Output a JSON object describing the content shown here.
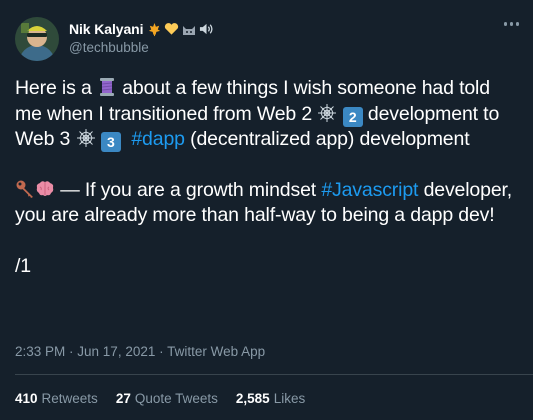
{
  "author": {
    "display_name": "Nik Kalyani",
    "handle": "@techbubble",
    "name_emojis": [
      "maple-leaf-icon",
      "yellow-heart-icon",
      "cat-icon",
      "speaker-icon"
    ]
  },
  "tweet": {
    "p1_a": "Here is a ",
    "p1_b": " about a few things I wish someone had told me when I transitioned from Web 2 ",
    "p1_c": " development to Web 3 ",
    "p1_key2": "2",
    "p1_key3": "3",
    "p1_hashtag": "#dapp",
    "p1_d": " (decentralized app) development",
    "p2_a": " — If you are a growth mindset ",
    "p2_hashtag": "#Javascript",
    "p2_b": " developer, you are already more than half-way to being a dapp dev!",
    "p3": "/1"
  },
  "meta": {
    "time": "2:33 PM",
    "sep1": " · ",
    "date": "Jun 17, 2021",
    "sep2": " · ",
    "source": "Twitter Web App"
  },
  "stats": {
    "retweets_count": "410",
    "retweets_label": "Retweets",
    "quotes_count": "27",
    "quotes_label": "Quote Tweets",
    "likes_count": "2,585",
    "likes_label": "Likes"
  },
  "colors": {
    "background": "#15202b",
    "hashtag": "#1d9bf0",
    "muted": "#8899a6",
    "divider": "#38444d"
  }
}
